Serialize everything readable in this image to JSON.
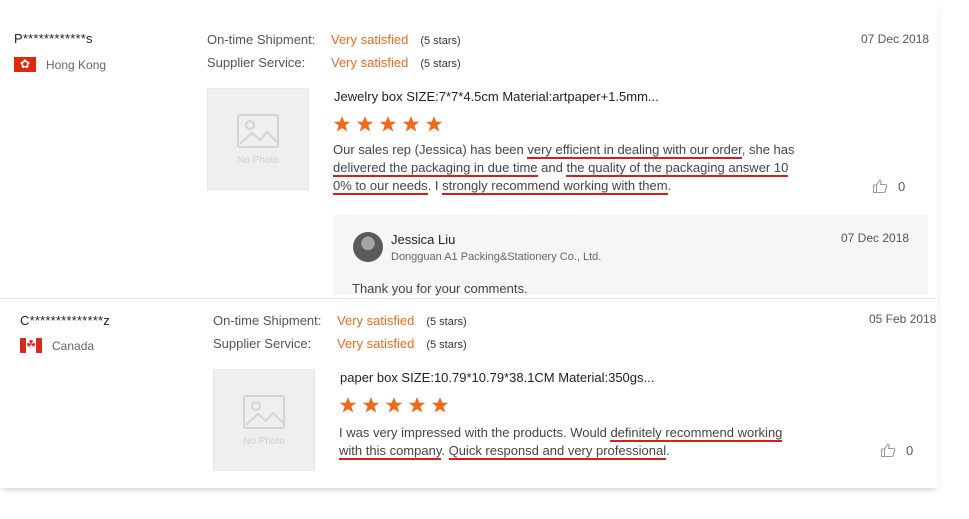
{
  "reviews": [
    {
      "buyer": "P************s",
      "country": "Hong Kong",
      "date": "07 Dec 2018",
      "ratings": [
        {
          "label": "On-time Shipment:",
          "value": "Very satisfied",
          "stars": "(5 stars)"
        },
        {
          "label": "Supplier Service:",
          "value": "Very satisfied",
          "stars": "(5 stars)"
        }
      ],
      "photo_placeholder": "No Photo",
      "product": "Jewelry box SIZE:7*7*4.5cm Material:artpaper+1.5mm...",
      "star_count": 5,
      "text": {
        "p1": "Our sales rep (Jessica) has been ",
        "u1": "very efficient in dealing with our order",
        "p2": ", she has ",
        "u2": "delivered the packaging in due time",
        "p3": " and ",
        "u3": "the quality of the packaging answer 10",
        "u4": "0% to our needs",
        "p4": ". I ",
        "u5": "strongly recommend working with them",
        "p5": "."
      },
      "helpful_count": "0",
      "reply": {
        "name": "Jessica Liu",
        "company": "Dongguan A1 Packing&Stationery Co., Ltd.",
        "date": "07 Dec 2018",
        "text": "Thank you for your comments."
      }
    },
    {
      "buyer": "C**************z",
      "country": "Canada",
      "date": "05 Feb 2018",
      "ratings": [
        {
          "label": "On-time Shipment:",
          "value": "Very satisfied",
          "stars": "(5 stars)"
        },
        {
          "label": "Supplier Service:",
          "value": "Very satisfied",
          "stars": "(5 stars)"
        }
      ],
      "photo_placeholder": "No Photo",
      "product": "paper box SIZE:10.79*10.79*38.1CM Material:350gs...",
      "star_count": 5,
      "text": {
        "p1": "I was very impressed  with the products.  Would ",
        "u1": "definitely  recommend working",
        "u2": "with this company",
        "p2": ".  ",
        "u3": "Quick  responsd and very professional",
        "p3": "."
      },
      "helpful_count": "0"
    }
  ],
  "colors": {
    "accent": "#ee6a1a",
    "underline": "#d91e18",
    "reply_bg": "#f4f6f8",
    "placeholder_bg": "#efefef"
  },
  "icons": {
    "star": "star-icon",
    "thumb": "thumbs-up-icon",
    "photo": "image-placeholder-icon"
  }
}
